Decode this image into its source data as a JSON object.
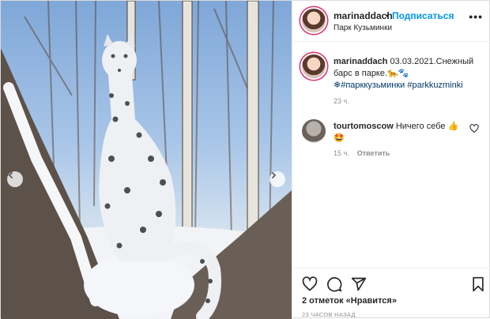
{
  "post": {
    "author": "marinaddach",
    "separator": "•",
    "follow_label": "Подписаться",
    "location": "Парк Кузьминки",
    "more_label": "•••"
  },
  "caption": {
    "username": "marinaddach",
    "text": " 03.03.2021.Снежный барс в парке.🐆🐾",
    "hashtag_1": "❄#парккузьминки",
    "hashtag_2": "#parkkuzminki",
    "time": "23 ч."
  },
  "comment": {
    "username": "tourtomoscow",
    "text": " Ничего себе 👍 🤩",
    "time": "15 ч.",
    "reply_label": "Ответить"
  },
  "footer": {
    "likes_prefix": "2 отметок ",
    "likes_link": "«Нравится»",
    "timestamp": "23 ЧАСОВ НАЗАД"
  },
  "icons": {
    "like": "heart-icon",
    "comment": "comment-icon",
    "share": "share-icon",
    "save": "bookmark-icon",
    "prev": "chevron-left-icon",
    "next": "chevron-right-icon"
  },
  "colors": {
    "link": "#0095f6",
    "hashtag": "#00376b",
    "muted": "#8e8e8e",
    "story_ring": "#e1306c"
  }
}
